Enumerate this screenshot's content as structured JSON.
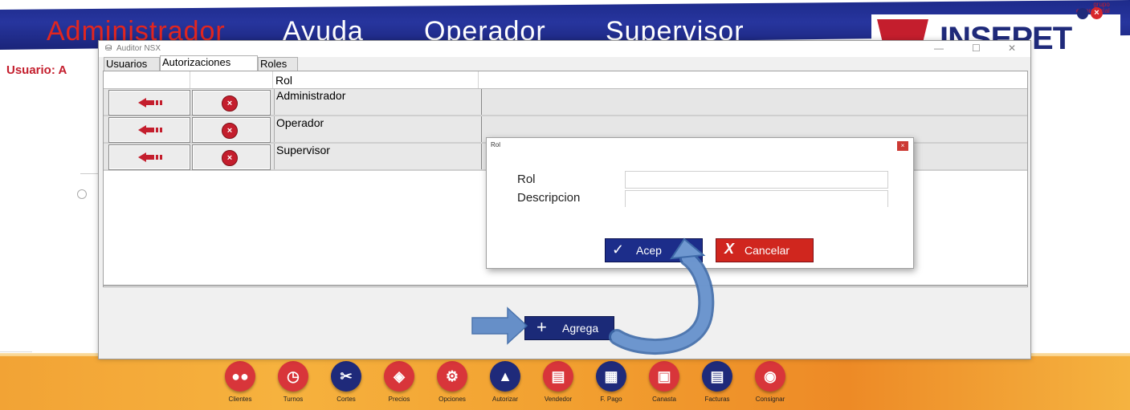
{
  "app": {
    "menu": [
      "Administrador",
      "Ayuda",
      "Operador",
      "Supervisor"
    ],
    "logo_text": "INSEPET",
    "logo_small": [
      "grupo",
      "empresarial"
    ],
    "user_label": "Usuario: A"
  },
  "window": {
    "title": "Auditor NSX",
    "controls": [
      "—",
      "☐",
      "✕"
    ],
    "tabs": [
      "Usuarios",
      "Autorizaciones",
      "Roles"
    ],
    "active_tab": "Autorizaciones",
    "grid": {
      "columns": [
        "",
        "",
        "Rol"
      ],
      "rows": [
        "Administrador",
        "Operador",
        "Supervisor"
      ]
    },
    "add_button": {
      "icon": "plus-icon",
      "label": "Agrega"
    }
  },
  "dialog": {
    "title": "Rol",
    "close": "×",
    "fields": {
      "rol_label": "Rol",
      "rol_value": "",
      "desc_label": "Descripcion",
      "desc_value": ""
    },
    "ok_button": {
      "icon": "check-icon",
      "label": "Acep"
    },
    "cancel_button": {
      "icon": "x-icon",
      "label": "Cancelar"
    }
  },
  "dock": [
    {
      "label": "Clientes",
      "icon": "users-icon",
      "color": "#d8353a"
    },
    {
      "label": "Turnos",
      "icon": "clock-icon",
      "color": "#d8353a"
    },
    {
      "label": "Cortes",
      "icon": "scissors-icon",
      "color": "#1f2a7a"
    },
    {
      "label": "Precios",
      "icon": "tag-icon",
      "color": "#d8353a"
    },
    {
      "label": "Opciones",
      "icon": "gears-icon",
      "color": "#d8353a"
    },
    {
      "label": "Autorizar",
      "icon": "thumbs-up-icon",
      "color": "#1f2a7a"
    },
    {
      "label": "Vendedor",
      "icon": "id-card-icon",
      "color": "#d8353a"
    },
    {
      "label": "F. Pago",
      "icon": "payment-icon",
      "color": "#1f2a7a"
    },
    {
      "label": "Canasta",
      "icon": "cart-icon",
      "color": "#d8353a"
    },
    {
      "label": "Facturas",
      "icon": "invoice-icon",
      "color": "#1f2a7a"
    },
    {
      "label": "Consignar",
      "icon": "safe-icon",
      "color": "#d8353a"
    }
  ]
}
